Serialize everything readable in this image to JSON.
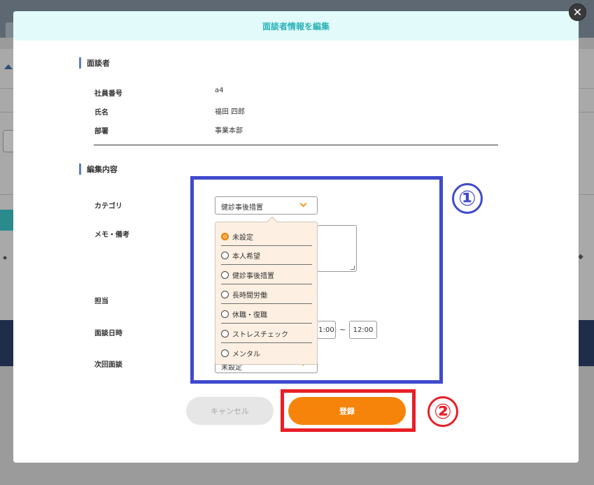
{
  "modal": {
    "title": "面談者情報を編集",
    "close_glyph": "✕"
  },
  "interviewee": {
    "section_title": "面談者",
    "employee_no_label": "社員番号",
    "employee_no": "a4",
    "name_label": "氏名",
    "name": "福田 四郎",
    "dept_label": "部署",
    "dept": "事業本部"
  },
  "edit": {
    "section_title": "編集内容",
    "category_label": "カテゴリ",
    "category_value": "健診事後措置",
    "memo_label": "メモ・備考",
    "assignee_label": "担当",
    "datetime_label": "面談日時",
    "time_start_partial": "1:00",
    "time_separator": "~",
    "time_end": "12:00",
    "next_label": "次回面談",
    "next_value_partial": "未設定"
  },
  "dropdown": {
    "options": [
      {
        "label": "未設定",
        "selected": true
      },
      {
        "label": "本人希望",
        "selected": false
      },
      {
        "label": "健診事後措置",
        "selected": false
      },
      {
        "label": "長時間労働",
        "selected": false
      },
      {
        "label": "休職・復職",
        "selected": false
      },
      {
        "label": "ストレスチェック",
        "selected": false
      },
      {
        "label": "メンタル",
        "selected": false
      }
    ]
  },
  "buttons": {
    "cancel": "キャンセル",
    "submit": "登録"
  },
  "annotations": {
    "one": "①",
    "two": "②"
  },
  "colors": {
    "accent_orange": "#f7840a",
    "header_teal": "#2bb3b9",
    "annotation_blue": "#3f4acb",
    "annotation_red": "#e81f27"
  }
}
